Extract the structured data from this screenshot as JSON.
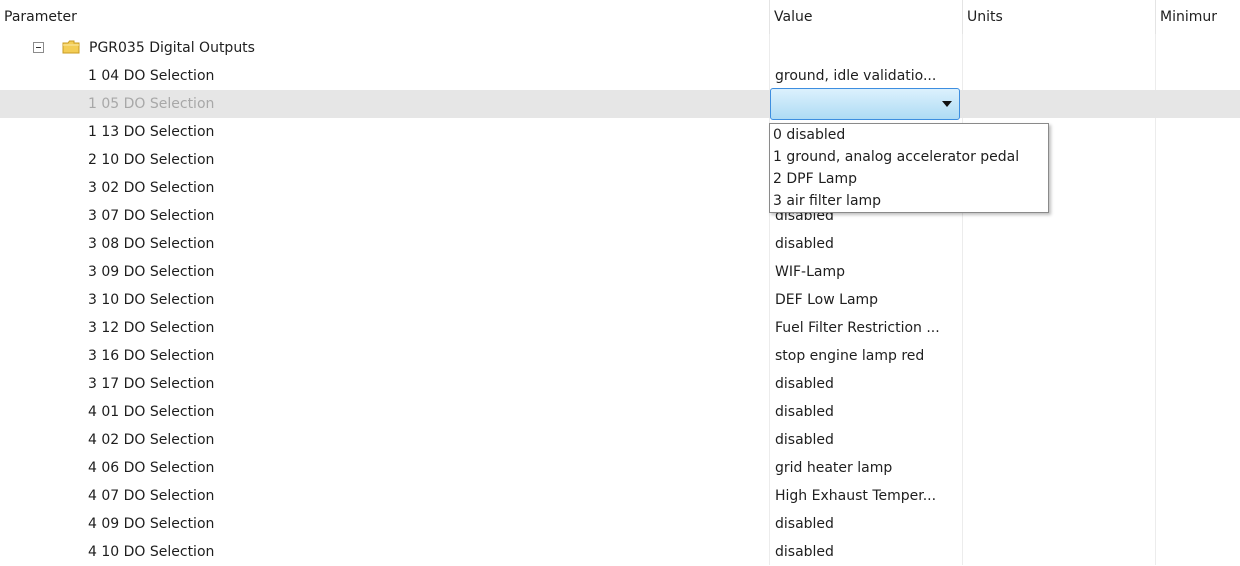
{
  "columns": {
    "parameter": "Parameter",
    "value": "Value",
    "units": "Units",
    "minimum": "Minimur"
  },
  "group": {
    "label": "PGR035 Digital Outputs",
    "expander_icon": "minus-box-icon",
    "folder_icon": "folder-icon"
  },
  "rows": [
    {
      "param": "1 04 DO Selection",
      "value": "ground, idle validatio..."
    },
    {
      "param": "1 05 DO Selection",
      "value": ""
    },
    {
      "param": "1 13 DO Selection",
      "value": ""
    },
    {
      "param": "2 10 DO Selection",
      "value": ""
    },
    {
      "param": "3 02 DO Selection",
      "value": ""
    },
    {
      "param": "3 07 DO Selection",
      "value": "disabled"
    },
    {
      "param": "3 08 DO Selection",
      "value": "disabled"
    },
    {
      "param": "3 09 DO Selection",
      "value": "WIF-Lamp"
    },
    {
      "param": "3 10 DO Selection",
      "value": "DEF Low Lamp"
    },
    {
      "param": "3 12 DO Selection",
      "value": "Fuel Filter Restriction ..."
    },
    {
      "param": "3 16 DO Selection",
      "value": "stop engine lamp red"
    },
    {
      "param": "3 17 DO Selection",
      "value": "disabled"
    },
    {
      "param": "4 01 DO Selection",
      "value": "disabled"
    },
    {
      "param": "4 02 DO Selection",
      "value": "disabled"
    },
    {
      "param": "4 06 DO Selection",
      "value": "grid heater lamp"
    },
    {
      "param": "4 07 DO Selection",
      "value": "High Exhaust Temper..."
    },
    {
      "param": "4 09 DO Selection",
      "value": "disabled"
    },
    {
      "param": "4 10 DO Selection",
      "value": "disabled"
    }
  ],
  "dropdown": {
    "selected_value": "",
    "arrow_icon": "chevron-down-icon",
    "options": [
      "0 disabled",
      "1 ground, analog accelerator pedal",
      "2 DPF Lamp",
      "3 air filter lamp"
    ]
  },
  "colors": {
    "selected_row": "#e6e6e6",
    "combo_border": "#3d8ee0",
    "combo_fill": "#aedbf4"
  }
}
